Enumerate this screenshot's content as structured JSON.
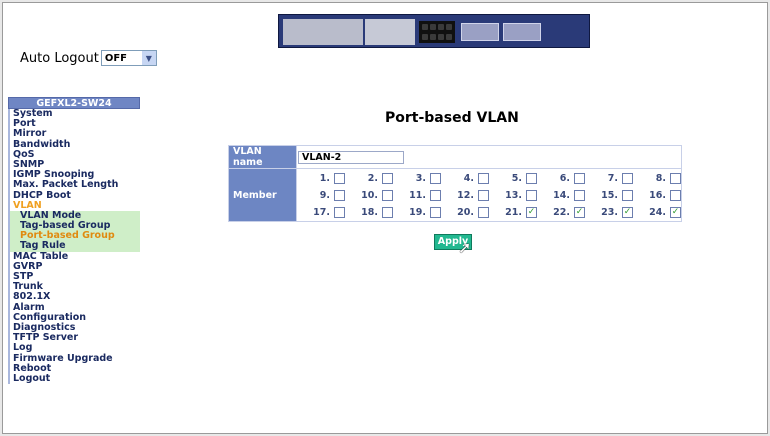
{
  "auto_logout": {
    "label": "Auto Logout",
    "value": "OFF"
  },
  "sidebar": {
    "header": "GEFXL2-SW24",
    "items": [
      {
        "label": "System",
        "type": "item"
      },
      {
        "label": "Port",
        "type": "item"
      },
      {
        "label": "Mirror",
        "type": "item"
      },
      {
        "label": "Bandwidth",
        "type": "item"
      },
      {
        "label": "QoS",
        "type": "item"
      },
      {
        "label": "SNMP",
        "type": "item"
      },
      {
        "label": "IGMP Snooping",
        "type": "item"
      },
      {
        "label": "Max. Packet Length",
        "type": "item"
      },
      {
        "label": "DHCP Boot",
        "type": "item"
      },
      {
        "label": "VLAN",
        "type": "item vlan"
      },
      {
        "label": "VLAN Mode",
        "type": "sub"
      },
      {
        "label": "Tag-based Group",
        "type": "sub"
      },
      {
        "label": "Port-based Group",
        "type": "sub active"
      },
      {
        "label": "Tag Rule",
        "type": "sub"
      },
      {
        "label": "MAC Table",
        "type": "item"
      },
      {
        "label": "GVRP",
        "type": "item"
      },
      {
        "label": "STP",
        "type": "item"
      },
      {
        "label": "Trunk",
        "type": "item"
      },
      {
        "label": "802.1X",
        "type": "item"
      },
      {
        "label": "Alarm",
        "type": "item"
      },
      {
        "label": "Configuration",
        "type": "item"
      },
      {
        "label": "Diagnostics",
        "type": "item"
      },
      {
        "label": "TFTP Server",
        "type": "item"
      },
      {
        "label": "Log",
        "type": "item"
      },
      {
        "label": "Firmware Upgrade",
        "type": "item"
      },
      {
        "label": "Reboot",
        "type": "item"
      },
      {
        "label": "Logout",
        "type": "item"
      }
    ]
  },
  "page": {
    "title": "Port-based VLAN",
    "vlan_name_label": "VLAN name",
    "vlan_name_value": "VLAN-2",
    "member_label": "Member",
    "ports": [
      {
        "label": "1.",
        "checked": false
      },
      {
        "label": "2.",
        "checked": false
      },
      {
        "label": "3.",
        "checked": false
      },
      {
        "label": "4.",
        "checked": false
      },
      {
        "label": "5.",
        "checked": false
      },
      {
        "label": "6.",
        "checked": false
      },
      {
        "label": "7.",
        "checked": false
      },
      {
        "label": "8.",
        "checked": false
      },
      {
        "label": "9.",
        "checked": false
      },
      {
        "label": "10.",
        "checked": false
      },
      {
        "label": "11.",
        "checked": false
      },
      {
        "label": "12.",
        "checked": false
      },
      {
        "label": "13.",
        "checked": false
      },
      {
        "label": "14.",
        "checked": false
      },
      {
        "label": "15.",
        "checked": false
      },
      {
        "label": "16.",
        "checked": false
      },
      {
        "label": "17.",
        "checked": false
      },
      {
        "label": "18.",
        "checked": false
      },
      {
        "label": "19.",
        "checked": false
      },
      {
        "label": "20.",
        "checked": false
      },
      {
        "label": "21.",
        "checked": true
      },
      {
        "label": "22.",
        "checked": true
      },
      {
        "label": "23.",
        "checked": true
      },
      {
        "label": "24.",
        "checked": true
      }
    ],
    "apply_label": "Apply"
  }
}
